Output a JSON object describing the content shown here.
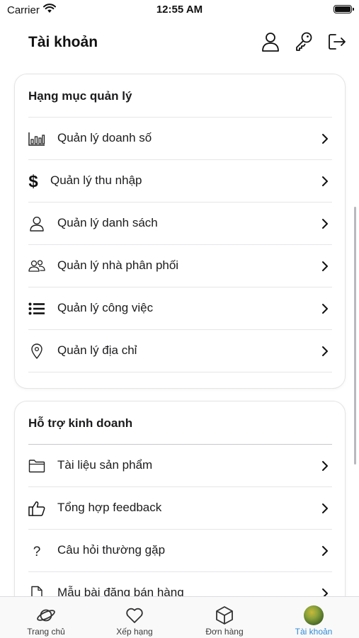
{
  "status_bar": {
    "carrier": "Carrier",
    "time": "12:55 AM"
  },
  "header": {
    "title": "Tài khoản",
    "actions": [
      "person-icon",
      "key-icon",
      "logout-icon"
    ]
  },
  "sections": [
    {
      "title": "Hạng mục quản lý",
      "items": [
        {
          "label": "Quản lý doanh số",
          "icon": "bar-chart-icon"
        },
        {
          "label": "Quản lý thu nhập",
          "icon": "dollar-icon"
        },
        {
          "label": "Quản lý danh sách",
          "icon": "person-icon"
        },
        {
          "label": "Quản lý nhà phân phối",
          "icon": "people-icon"
        },
        {
          "label": "Quản lý công việc",
          "icon": "list-icon"
        },
        {
          "label": "Quản lý địa chỉ",
          "icon": "location-pin-icon"
        }
      ]
    },
    {
      "title": "Hỗ trợ kinh doanh",
      "items": [
        {
          "label": "Tài liệu sản phẩm",
          "icon": "folder-icon"
        },
        {
          "label": "Tổng hợp feedback",
          "icon": "thumbs-up-icon"
        },
        {
          "label": "Câu hỏi thường gặp",
          "icon": "question-icon"
        },
        {
          "label": "Mẫu bài đăng bán hàng",
          "icon": "document-icon"
        }
      ]
    }
  ],
  "tabbar": {
    "tabs": [
      {
        "label": "Trang chủ",
        "icon": "planet-icon",
        "active": false
      },
      {
        "label": "Xếp hạng",
        "icon": "heart-icon",
        "active": false
      },
      {
        "label": "Đơn hàng",
        "icon": "box-icon",
        "active": false
      },
      {
        "label": "Tài khoản",
        "icon": "avatar",
        "active": true
      }
    ],
    "active_color": "#2f8bd6"
  }
}
